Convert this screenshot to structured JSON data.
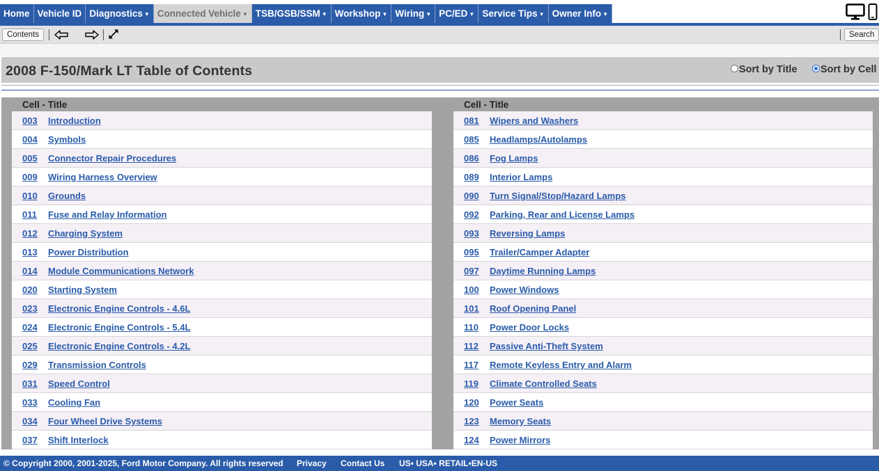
{
  "nav": {
    "tabs": [
      {
        "label": "Home",
        "caret": false,
        "active": true
      },
      {
        "label": "Vehicle ID",
        "caret": false,
        "active": true
      },
      {
        "label": "Diagnostics",
        "caret": true,
        "active": true
      },
      {
        "label": "Connected Vehicle",
        "caret": true,
        "active": false
      },
      {
        "label": "TSB/GSB/SSM",
        "caret": true,
        "active": true
      },
      {
        "label": "Workshop",
        "caret": true,
        "active": true
      },
      {
        "label": "Wiring",
        "caret": true,
        "active": true
      },
      {
        "label": "PC/ED",
        "caret": true,
        "active": true
      },
      {
        "label": "Service Tips",
        "caret": true,
        "active": true
      },
      {
        "label": "Owner Info",
        "caret": true,
        "active": true
      }
    ],
    "caret_glyph": "▼"
  },
  "toolbar": {
    "contents_label": "Contents",
    "search_label": "Search"
  },
  "page": {
    "title": "2008 F-150/Mark LT Table of Contents",
    "sort_by_title": "Sort by Title",
    "sort_by_cell": "Sort by Cell",
    "sort_selected": "cell"
  },
  "toc": {
    "column_header": "Cell - Title",
    "left": [
      {
        "cell": "003",
        "title": "Introduction"
      },
      {
        "cell": "004",
        "title": "Symbols"
      },
      {
        "cell": "005",
        "title": "Connector Repair Procedures"
      },
      {
        "cell": "009",
        "title": "Wiring Harness Overview"
      },
      {
        "cell": "010",
        "title": "Grounds"
      },
      {
        "cell": "011",
        "title": "Fuse and Relay Information"
      },
      {
        "cell": "012",
        "title": "Charging System"
      },
      {
        "cell": "013",
        "title": "Power Distribution"
      },
      {
        "cell": "014",
        "title": "Module Communications Network"
      },
      {
        "cell": "020",
        "title": "Starting System"
      },
      {
        "cell": "023",
        "title": "Electronic Engine Controls - 4.6L"
      },
      {
        "cell": "024",
        "title": "Electronic Engine Controls - 5.4L"
      },
      {
        "cell": "025",
        "title": "Electronic Engine Controls - 4.2L"
      },
      {
        "cell": "029",
        "title": "Transmission Controls"
      },
      {
        "cell": "031",
        "title": "Speed Control"
      },
      {
        "cell": "033",
        "title": "Cooling Fan"
      },
      {
        "cell": "034",
        "title": "Four Wheel Drive Systems"
      },
      {
        "cell": "037",
        "title": "Shift Interlock"
      }
    ],
    "right": [
      {
        "cell": "081",
        "title": "Wipers and Washers"
      },
      {
        "cell": "085",
        "title": "Headlamps/Autolamps"
      },
      {
        "cell": "086",
        "title": "Fog Lamps"
      },
      {
        "cell": "089",
        "title": "Interior Lamps"
      },
      {
        "cell": "090",
        "title": "Turn Signal/Stop/Hazard Lamps"
      },
      {
        "cell": "092",
        "title": "Parking, Rear and License Lamps"
      },
      {
        "cell": "093",
        "title": "Reversing Lamps"
      },
      {
        "cell": "095",
        "title": "Trailer/Camper Adapter"
      },
      {
        "cell": "097",
        "title": "Daytime Running Lamps"
      },
      {
        "cell": "100",
        "title": "Power Windows"
      },
      {
        "cell": "101",
        "title": "Roof Opening Panel"
      },
      {
        "cell": "110",
        "title": "Power Door Locks"
      },
      {
        "cell": "112",
        "title": "Passive Anti-Theft System"
      },
      {
        "cell": "117",
        "title": "Remote Keyless Entry and Alarm"
      },
      {
        "cell": "119",
        "title": "Climate Controlled Seats"
      },
      {
        "cell": "120",
        "title": "Power Seats"
      },
      {
        "cell": "123",
        "title": "Memory Seats"
      },
      {
        "cell": "124",
        "title": "Power Mirrors"
      }
    ]
  },
  "footer": {
    "copyright": "© Copyright 2000, 2001-2025, Ford Motor Company. All rights reserved",
    "privacy": "Privacy",
    "contact": "Contact Us",
    "locale": "US• USA• RETAIL•EN-US"
  },
  "colors": {
    "brand_blue": "#2a5caa",
    "link_blue": "#2a5caa",
    "row_alt": "#f5eff6",
    "header_gray": "#c9c9c9",
    "inactive_tab": "#d4d4d4"
  }
}
